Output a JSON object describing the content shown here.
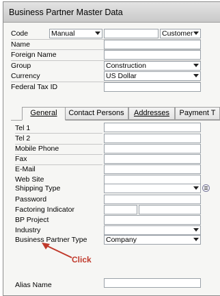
{
  "window": {
    "title": "Business Partner Master Data"
  },
  "header": {
    "code_label": "Code",
    "code_series": "Manual",
    "code_value": "",
    "type_value": "Customer",
    "name_label": "Name",
    "foreign_name_label": "Foreign Name",
    "group_label": "Group",
    "group_value": "Construction",
    "currency_label": "Currency",
    "currency_value": "US Dollar",
    "federal_tax_label": "Federal Tax ID"
  },
  "tabs": [
    {
      "label": "General",
      "active": true
    },
    {
      "label": "Contact Persons",
      "active": false
    },
    {
      "label": "Addresses",
      "active": false
    },
    {
      "label": "Payment T",
      "active": false
    }
  ],
  "general": {
    "tel1_label": "Tel 1",
    "tel2_label": "Tel 2",
    "mobile_label": "Mobile Phone",
    "fax_label": "Fax",
    "email_label": "E-Mail",
    "website_label": "Web Site",
    "shipping_label": "Shipping Type",
    "password_label": "Password",
    "factoring_label": "Factoring Indicator",
    "bp_project_label": "BP Project",
    "industry_label": "Industry",
    "bp_type_label": "Business Partner Type",
    "bp_type_value": "Company",
    "alias_label": "Alias Name"
  },
  "annotation": {
    "text": "Click",
    "color": "#c0392b"
  }
}
